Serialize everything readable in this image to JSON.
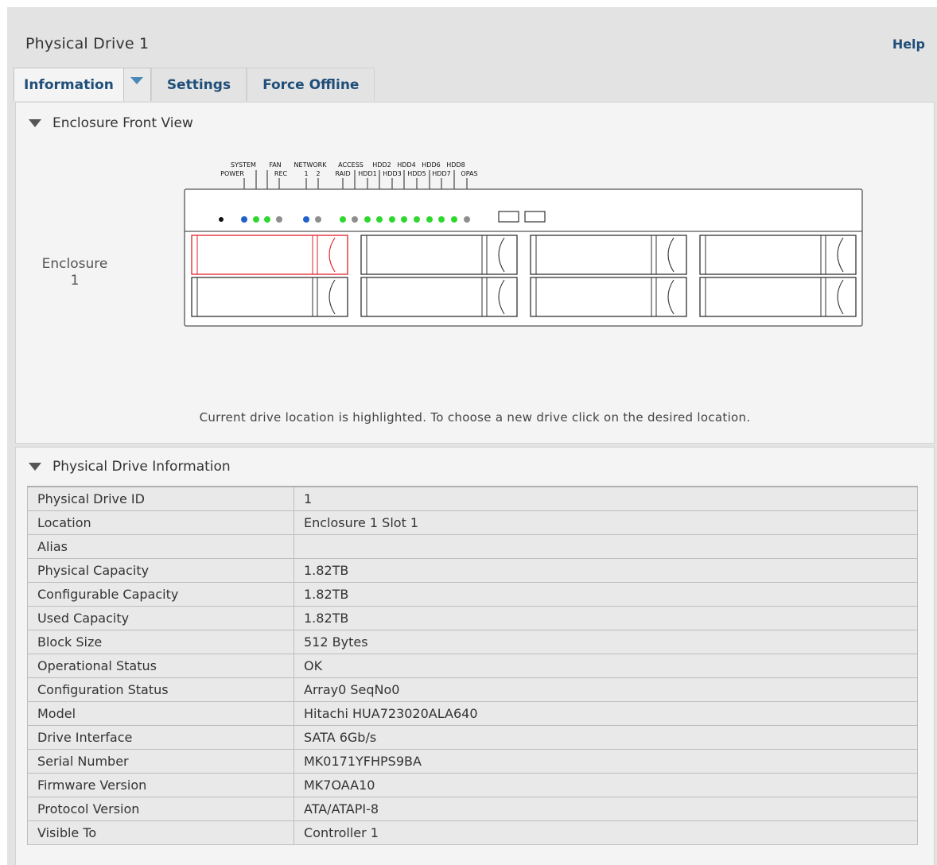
{
  "header": {
    "title": "Physical Drive 1",
    "help_label": "Help"
  },
  "tabs": [
    {
      "label": "Information",
      "active": true
    },
    {
      "label": "Settings"
    },
    {
      "label": "Force Offline"
    }
  ],
  "front_view": {
    "section_title": "Enclosure Front View",
    "enclosure_label": "Enclosure\n1",
    "indicator_labels_top": [
      "SYSTEM",
      "FAN",
      "NETWORK",
      "ACCESS",
      "HDD2",
      "HDD4",
      "HDD6",
      "HDD8"
    ],
    "indicator_labels_bottom": [
      "POWER",
      "REC",
      "1",
      "2",
      "RAID",
      "HDD1",
      "HDD3",
      "HDD5",
      "HDD7",
      "OPAS"
    ],
    "hint": "Current drive location is highlighted. To choose a new drive click on the desired location.",
    "selected_slot": 1,
    "colors": {
      "blue": "#1f62c9",
      "green": "#2fd82f",
      "gray": "#8f8f8f",
      "highlight": "#e0202a"
    }
  },
  "info": {
    "section_title": "Physical Drive Information",
    "rows": [
      {
        "label": "Physical Drive ID",
        "value": "1"
      },
      {
        "label": "Location",
        "value": "Enclosure 1 Slot 1"
      },
      {
        "label": "Alias",
        "value": ""
      },
      {
        "label": "Physical Capacity",
        "value": "1.82TB"
      },
      {
        "label": "Configurable Capacity",
        "value": "1.82TB"
      },
      {
        "label": "Used Capacity",
        "value": "1.82TB"
      },
      {
        "label": "Block Size",
        "value": "512 Bytes"
      },
      {
        "label": "Operational Status",
        "value": "OK"
      },
      {
        "label": "Configuration Status",
        "value": "Array0 SeqNo0"
      },
      {
        "label": "Model",
        "value": "Hitachi HUA723020ALA640"
      },
      {
        "label": "Drive Interface",
        "value": "SATA 6Gb/s"
      },
      {
        "label": "Serial Number",
        "value": "MK0171YFHPS9BA"
      },
      {
        "label": "Firmware Version",
        "value": "MK7OAA10"
      },
      {
        "label": "Protocol Version",
        "value": "ATA/ATAPI-8"
      },
      {
        "label": "Visible To",
        "value": "Controller 1"
      }
    ]
  }
}
